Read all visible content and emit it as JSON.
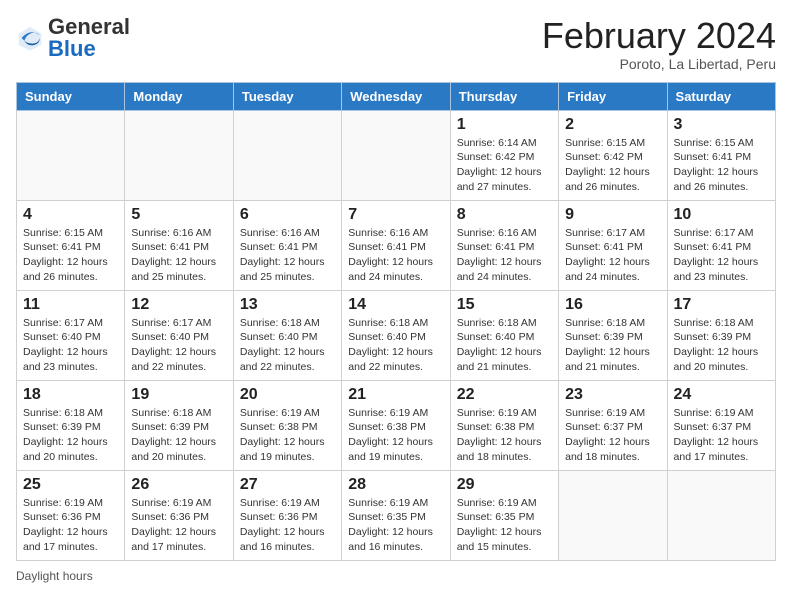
{
  "header": {
    "logo_general": "General",
    "logo_blue": "Blue",
    "month_title": "February 2024",
    "location": "Poroto, La Libertad, Peru"
  },
  "days_of_week": [
    "Sunday",
    "Monday",
    "Tuesday",
    "Wednesday",
    "Thursday",
    "Friday",
    "Saturday"
  ],
  "weeks": [
    [
      {
        "day": "",
        "info": ""
      },
      {
        "day": "",
        "info": ""
      },
      {
        "day": "",
        "info": ""
      },
      {
        "day": "",
        "info": ""
      },
      {
        "day": "1",
        "info": "Sunrise: 6:14 AM\nSunset: 6:42 PM\nDaylight: 12 hours and 27 minutes."
      },
      {
        "day": "2",
        "info": "Sunrise: 6:15 AM\nSunset: 6:42 PM\nDaylight: 12 hours and 26 minutes."
      },
      {
        "day": "3",
        "info": "Sunrise: 6:15 AM\nSunset: 6:41 PM\nDaylight: 12 hours and 26 minutes."
      }
    ],
    [
      {
        "day": "4",
        "info": "Sunrise: 6:15 AM\nSunset: 6:41 PM\nDaylight: 12 hours and 26 minutes."
      },
      {
        "day": "5",
        "info": "Sunrise: 6:16 AM\nSunset: 6:41 PM\nDaylight: 12 hours and 25 minutes."
      },
      {
        "day": "6",
        "info": "Sunrise: 6:16 AM\nSunset: 6:41 PM\nDaylight: 12 hours and 25 minutes."
      },
      {
        "day": "7",
        "info": "Sunrise: 6:16 AM\nSunset: 6:41 PM\nDaylight: 12 hours and 24 minutes."
      },
      {
        "day": "8",
        "info": "Sunrise: 6:16 AM\nSunset: 6:41 PM\nDaylight: 12 hours and 24 minutes."
      },
      {
        "day": "9",
        "info": "Sunrise: 6:17 AM\nSunset: 6:41 PM\nDaylight: 12 hours and 24 minutes."
      },
      {
        "day": "10",
        "info": "Sunrise: 6:17 AM\nSunset: 6:41 PM\nDaylight: 12 hours and 23 minutes."
      }
    ],
    [
      {
        "day": "11",
        "info": "Sunrise: 6:17 AM\nSunset: 6:40 PM\nDaylight: 12 hours and 23 minutes."
      },
      {
        "day": "12",
        "info": "Sunrise: 6:17 AM\nSunset: 6:40 PM\nDaylight: 12 hours and 22 minutes."
      },
      {
        "day": "13",
        "info": "Sunrise: 6:18 AM\nSunset: 6:40 PM\nDaylight: 12 hours and 22 minutes."
      },
      {
        "day": "14",
        "info": "Sunrise: 6:18 AM\nSunset: 6:40 PM\nDaylight: 12 hours and 22 minutes."
      },
      {
        "day": "15",
        "info": "Sunrise: 6:18 AM\nSunset: 6:40 PM\nDaylight: 12 hours and 21 minutes."
      },
      {
        "day": "16",
        "info": "Sunrise: 6:18 AM\nSunset: 6:39 PM\nDaylight: 12 hours and 21 minutes."
      },
      {
        "day": "17",
        "info": "Sunrise: 6:18 AM\nSunset: 6:39 PM\nDaylight: 12 hours and 20 minutes."
      }
    ],
    [
      {
        "day": "18",
        "info": "Sunrise: 6:18 AM\nSunset: 6:39 PM\nDaylight: 12 hours and 20 minutes."
      },
      {
        "day": "19",
        "info": "Sunrise: 6:18 AM\nSunset: 6:39 PM\nDaylight: 12 hours and 20 minutes."
      },
      {
        "day": "20",
        "info": "Sunrise: 6:19 AM\nSunset: 6:38 PM\nDaylight: 12 hours and 19 minutes."
      },
      {
        "day": "21",
        "info": "Sunrise: 6:19 AM\nSunset: 6:38 PM\nDaylight: 12 hours and 19 minutes."
      },
      {
        "day": "22",
        "info": "Sunrise: 6:19 AM\nSunset: 6:38 PM\nDaylight: 12 hours and 18 minutes."
      },
      {
        "day": "23",
        "info": "Sunrise: 6:19 AM\nSunset: 6:37 PM\nDaylight: 12 hours and 18 minutes."
      },
      {
        "day": "24",
        "info": "Sunrise: 6:19 AM\nSunset: 6:37 PM\nDaylight: 12 hours and 17 minutes."
      }
    ],
    [
      {
        "day": "25",
        "info": "Sunrise: 6:19 AM\nSunset: 6:36 PM\nDaylight: 12 hours and 17 minutes."
      },
      {
        "day": "26",
        "info": "Sunrise: 6:19 AM\nSunset: 6:36 PM\nDaylight: 12 hours and 17 minutes."
      },
      {
        "day": "27",
        "info": "Sunrise: 6:19 AM\nSunset: 6:36 PM\nDaylight: 12 hours and 16 minutes."
      },
      {
        "day": "28",
        "info": "Sunrise: 6:19 AM\nSunset: 6:35 PM\nDaylight: 12 hours and 16 minutes."
      },
      {
        "day": "29",
        "info": "Sunrise: 6:19 AM\nSunset: 6:35 PM\nDaylight: 12 hours and 15 minutes."
      },
      {
        "day": "",
        "info": ""
      },
      {
        "day": "",
        "info": ""
      }
    ]
  ],
  "footer": {
    "daylight_label": "Daylight hours"
  }
}
